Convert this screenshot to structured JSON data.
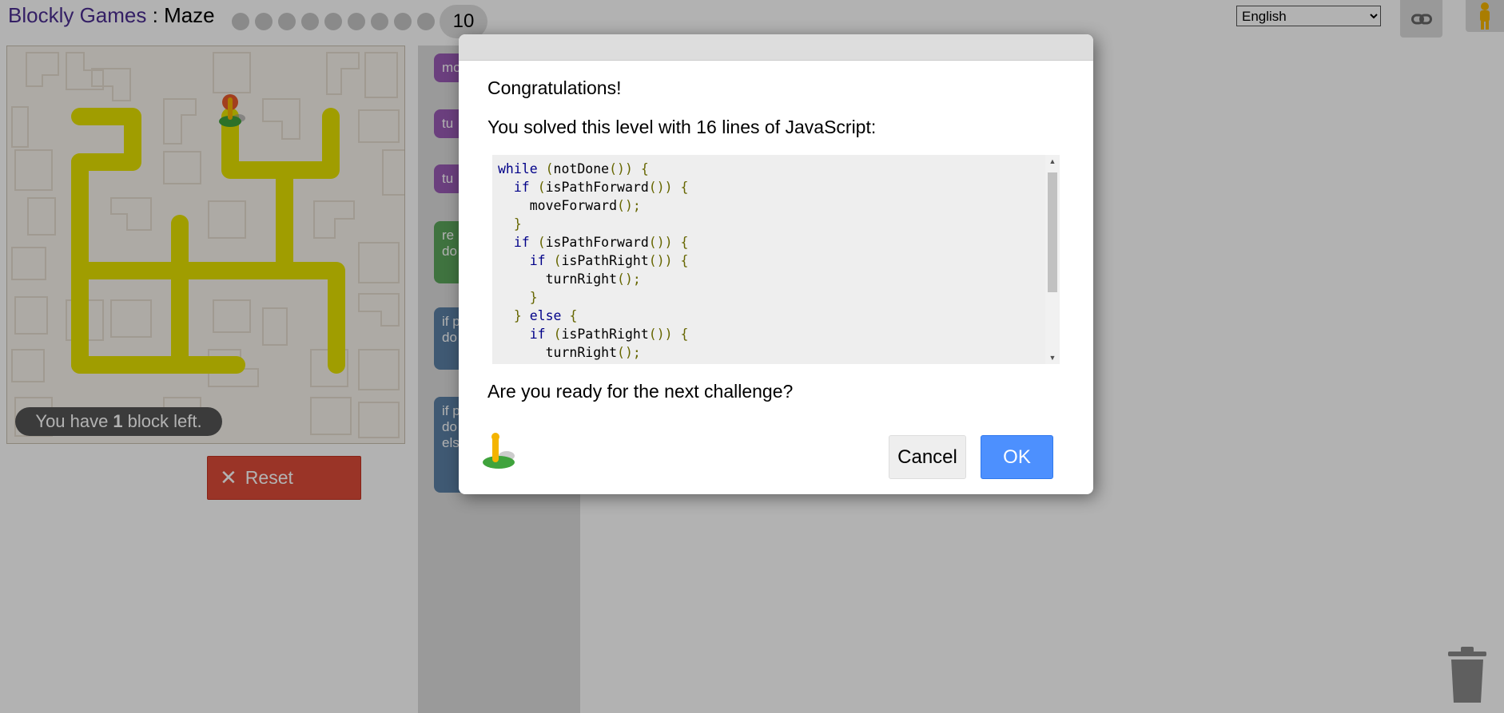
{
  "header": {
    "app_name": "Blockly Games",
    "separator": " : ",
    "game_name": "Maze",
    "current_level": "10",
    "language_selected": "English",
    "link_icon": "link-icon",
    "avatar_icon": "pegman-avatar-icon"
  },
  "maze": {
    "capacity_prefix": "You have",
    "capacity_count": "1",
    "capacity_suffix": "block left.",
    "reset_label": "Reset",
    "reset_icon": "close-icon"
  },
  "toolbox": {
    "blocks": [
      "mo",
      "tu",
      "tu",
      "re\ndo",
      "if p\ndo",
      "if p\ndo\nels"
    ]
  },
  "dialog": {
    "title": "Congratulations!",
    "summary": "You solved this level with 16 lines of JavaScript:",
    "code_lines": [
      "while (notDone()) {",
      "  if (isPathForward()) {",
      "    moveForward();",
      "  }",
      "  if (isPathForward()) {",
      "    if (isPathRight()) {",
      "      turnRight();",
      "    }",
      "  } else {",
      "    if (isPathRight()) {",
      "      turnRight();"
    ],
    "prompt": "Are you ready for the next challenge?",
    "cancel_label": "Cancel",
    "ok_label": "OK",
    "pegman_icon": "pegman-icon"
  },
  "colors": {
    "brand": "#4b2d91",
    "path": "#e5e100",
    "reset": "#dd4b39",
    "ok": "#4d90fe",
    "overlay": "rgba(0,0,0,0.3)"
  }
}
